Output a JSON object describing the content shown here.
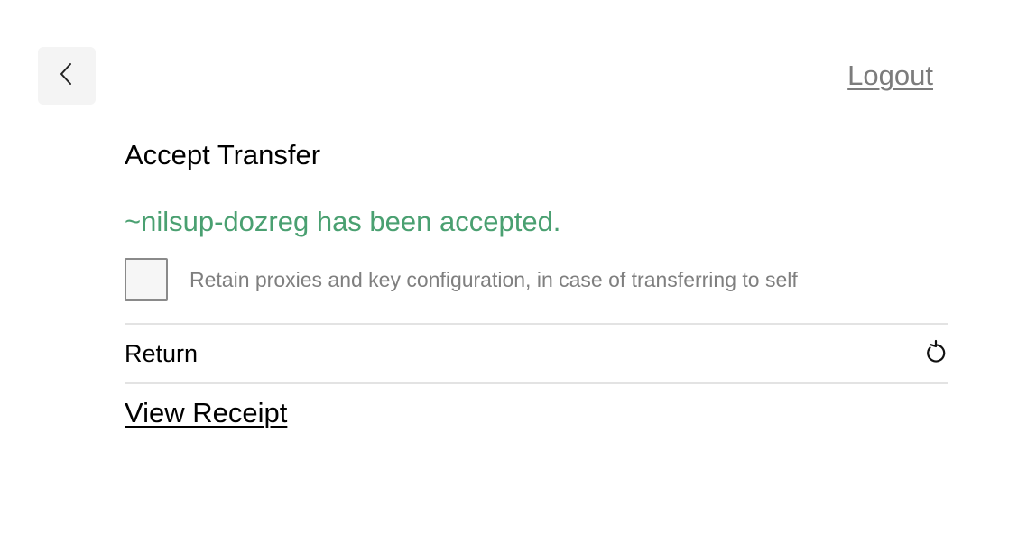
{
  "header": {
    "back_icon": "chevron-left-icon",
    "logout_label": "Logout"
  },
  "main": {
    "title": "Accept Transfer",
    "success_message": "~nilsup-dozreg has been accepted.",
    "retain_checkbox": {
      "checked": false,
      "label": "Retain proxies and key configuration, in case of transferring to self"
    },
    "return_label": "Return",
    "return_icon": "undo-icon",
    "view_receipt_label": "View Receipt"
  },
  "colors": {
    "success": "#4aa071",
    "muted": "#7c7c7c",
    "button_bg": "#f4f4f4"
  }
}
